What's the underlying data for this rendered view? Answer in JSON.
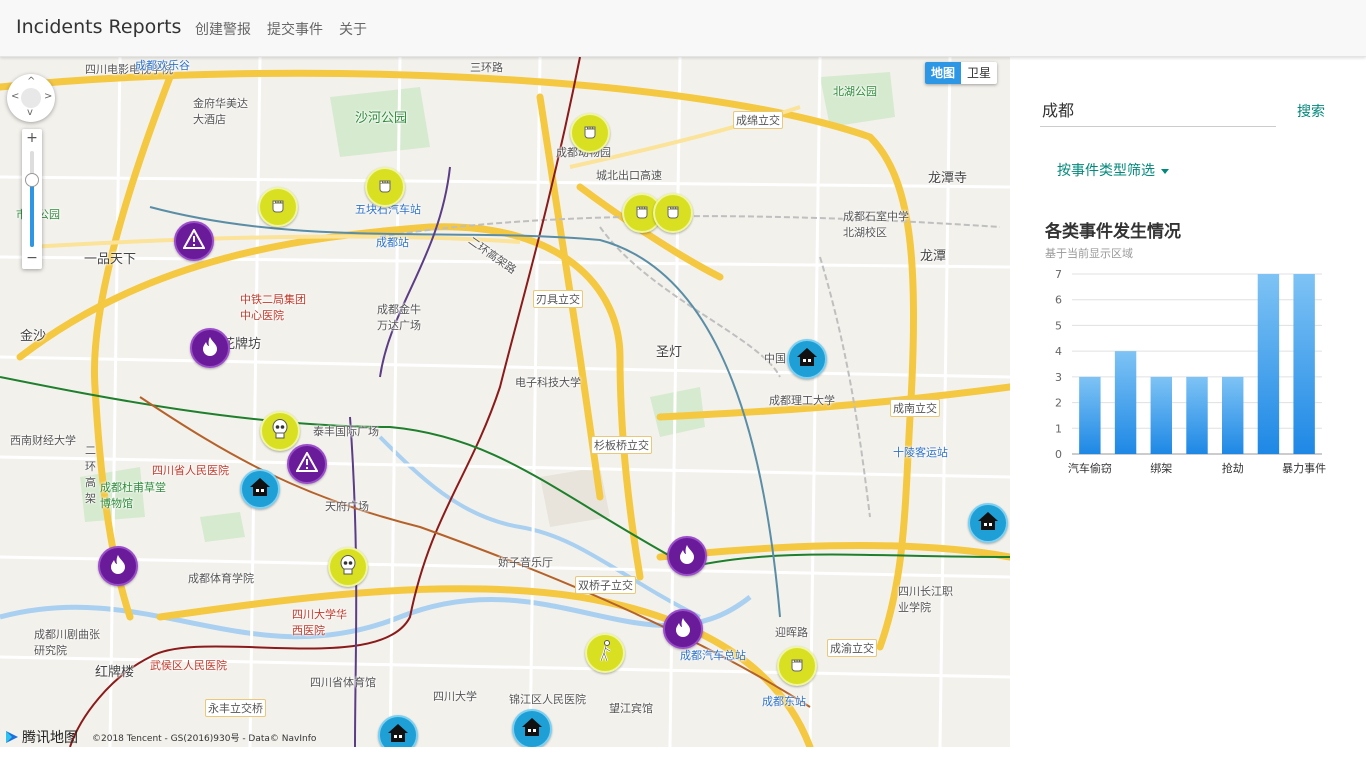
{
  "navbar": {
    "brand": "Incidents Reports",
    "links": [
      "创建警报",
      "提交事件",
      "关于"
    ]
  },
  "map": {
    "type_toggle": {
      "map": "地图",
      "satellite": "卫星"
    },
    "logo": "腾讯地图",
    "copyright": "©2018 Tencent - GS(2016)930号 - Data© NavInfo",
    "places": [
      "四川电影电视学院",
      "成都欢乐谷",
      "金府华美达大酒店",
      "三环路",
      "沙河公园",
      "北湖公园",
      "成都动物园",
      "成绵立交",
      "城北出口高速",
      "龙潭寺",
      "五块石汽车站",
      "成都站",
      "成都石室中学北湖校区",
      "龙潭",
      "市政公园",
      "一品天下",
      "中铁二局集团中心医院",
      "成都金牛万达广场",
      "刃具立交",
      "二环高架路",
      "金沙",
      "花牌坊",
      "电子科技大学",
      "圣灯",
      "成都理工大学",
      "西南财经大学",
      "泰丰国际广场",
      "四川省人民医院",
      "成都杜甫草堂博物馆",
      "杉板桥立交",
      "成南立交",
      "十陵客运站",
      "天府广场",
      "娇子音乐厅",
      "成都体育学院",
      "双桥子立交",
      "四川长江职业学院",
      "四川大学华西医院",
      "成都川剧曲张研究院",
      "成都汽车总站",
      "成渝立交",
      "红牌楼",
      "武侯区人民医院",
      "四川省体育馆",
      "四川大学",
      "锦江区人民医院",
      "望江宾馆",
      "成都东站",
      "永丰立交桥",
      "中国",
      "二环高架",
      "迎晖路",
      "三环路"
    ]
  },
  "sidebar": {
    "search_value": "成都",
    "search_button": "搜索",
    "filter_label": "按事件类型筛选",
    "chart_title": "各类事件发生情况",
    "chart_subtitle": "基于当前显示区域"
  },
  "chart_data": {
    "type": "bar",
    "categories": [
      "汽车偷窃",
      "",
      "绑架",
      "",
      "抢劫",
      "",
      "暴力事件"
    ],
    "values": [
      3,
      4,
      3,
      3,
      3,
      7,
      7
    ],
    "ylim": [
      0,
      7
    ],
    "yticks": [
      0,
      1,
      2,
      3,
      4,
      5,
      6,
      7
    ],
    "grid": true,
    "bar_color_top": "#7ec3f5",
    "bar_color_bottom": "#1e88e5"
  },
  "colors": {
    "accent": "#00897b",
    "map_active": "#2e97e5",
    "fight_marker": "#d9e021",
    "fire_marker": "#6a1b9a",
    "house_marker": "#1e9fd6"
  },
  "markers": [
    {
      "icon": "fist-icon"
    },
    {
      "icon": "fist-icon"
    },
    {
      "icon": "fist-icon"
    },
    {
      "icon": "fist-icon"
    },
    {
      "icon": "fist-icon"
    },
    {
      "icon": "fist-icon"
    },
    {
      "icon": "warning-icon"
    },
    {
      "icon": "warning-icon"
    },
    {
      "icon": "fire-icon"
    },
    {
      "icon": "fire-icon"
    },
    {
      "icon": "fire-icon"
    },
    {
      "icon": "fire-icon"
    },
    {
      "icon": "skull-icon"
    },
    {
      "icon": "skull-icon"
    },
    {
      "icon": "house-icon"
    },
    {
      "icon": "house-icon"
    },
    {
      "icon": "house-icon"
    },
    {
      "icon": "house-icon"
    },
    {
      "icon": "house-icon"
    },
    {
      "icon": "person-icon"
    }
  ]
}
